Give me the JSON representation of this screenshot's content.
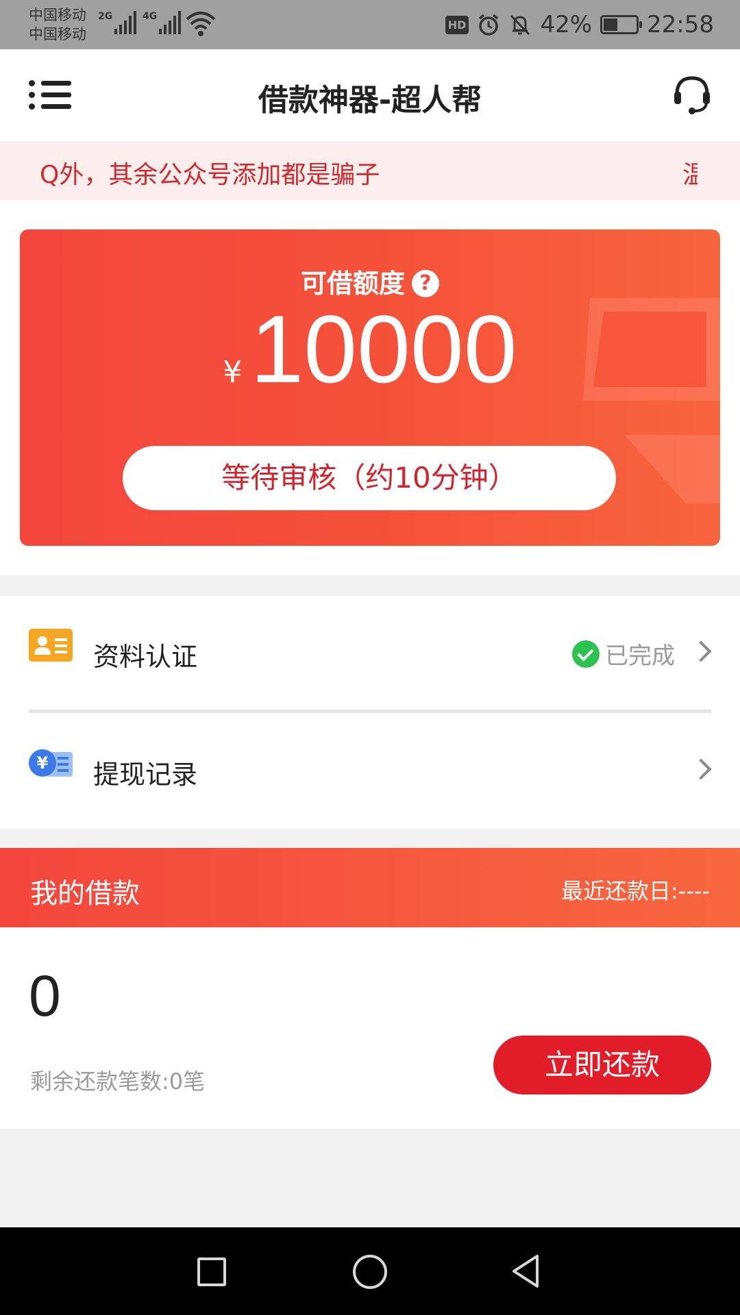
{
  "status_bar": {
    "carrier_1": "中国移动",
    "carrier_2": "中国移动",
    "net_1": "2G",
    "net_2": "4G",
    "hd": "HD",
    "battery": "42%",
    "battery_level": 0.42,
    "time": "22:58"
  },
  "header": {
    "title": "借款神器-超人帮"
  },
  "notice": {
    "text": "Q外，其余公众号添加都是骗子",
    "next_text": "温"
  },
  "credit_card": {
    "label": "可借额度",
    "help_glyph": "?",
    "currency": "¥",
    "amount": "10000",
    "review_button": "等待审核（约10分钟）"
  },
  "list": {
    "items": [
      {
        "label": "资料认证",
        "status": "已完成"
      },
      {
        "label": "提现记录",
        "status": ""
      }
    ]
  },
  "my_loans": {
    "title": "我的借款",
    "due_date": "最近还款日:----",
    "count": "0",
    "remaining": "剩余还款笔数:0笔",
    "repay_button": "立即还款"
  },
  "colors": {
    "brand_red": "#f3463d",
    "button_red": "#e11d2a",
    "notice_text": "#d2292f",
    "check_green": "#2cc24f",
    "icon_orange": "#f5a623",
    "icon_blue": "#3b7ae8"
  },
  "icons": [
    "menu-icon",
    "headset-icon",
    "help-icon",
    "id-card-icon",
    "check-icon",
    "chevron-right-icon",
    "yuan-list-icon",
    "nav-recent-icon",
    "nav-home-icon",
    "nav-back-icon"
  ]
}
